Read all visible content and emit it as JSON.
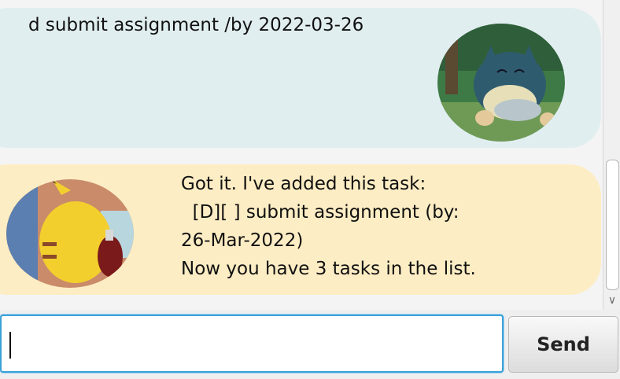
{
  "user_message": {
    "text": "d submit assignment /by 2022-03-26",
    "avatar_icon": "munchlax-avatar"
  },
  "bot_message": {
    "text": "Got it. I've added this task:\n  [D][ ] submit assignment (by:\n26-Mar-2022)\nNow you have 3 tasks in the list.",
    "avatar_icon": "pikachu-avatar"
  },
  "input": {
    "value": "",
    "placeholder": ""
  },
  "send_button": {
    "label": "Send"
  },
  "colors": {
    "user_bubble": "#e1eef0",
    "bot_bubble": "#fdedc4",
    "input_focus": "#3aa1d8"
  }
}
